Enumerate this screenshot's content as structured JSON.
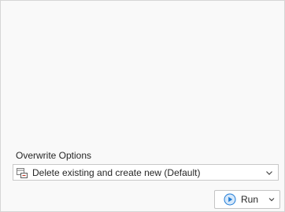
{
  "overwrite": {
    "section_label": "Overwrite Options",
    "selected_value": "Delete existing and create new (Default)"
  },
  "run_button": {
    "label": "Run"
  },
  "icons": {
    "option_icon": "overwrite-table-icon",
    "dropdown": "chevron-down-icon",
    "run": "play-circle-icon"
  },
  "colors": {
    "accent": "#1f7bd6",
    "panel_background": "#f9f9f9",
    "border": "#c8c8c8"
  }
}
